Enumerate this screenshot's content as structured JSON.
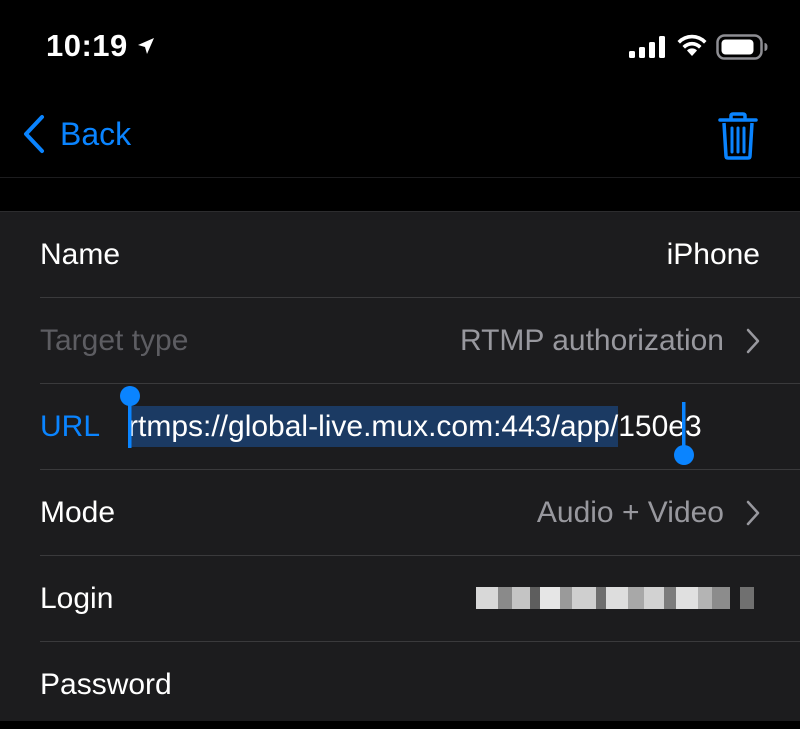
{
  "status_bar": {
    "time": "10:19",
    "icons": [
      "location-arrow-icon",
      "cellular-signal-icon",
      "wifi-icon",
      "battery-icon"
    ]
  },
  "nav": {
    "back_label": "Back",
    "trash_icon": "trash-icon"
  },
  "rows": {
    "name": {
      "label": "Name",
      "value": "iPhone"
    },
    "target_type": {
      "label": "Target type",
      "value": "RTMP authorization"
    },
    "url": {
      "label": "URL",
      "selected_text": "rtmps://global-live.mux.com:443/app/",
      "trailing_text": "150e3"
    },
    "mode": {
      "label": "Mode",
      "value": "Audio + Video"
    },
    "login": {
      "label": "Login",
      "value_redacted": true
    },
    "password": {
      "label": "Password"
    }
  },
  "colors": {
    "accent": "#0a84ff",
    "background": "#000000",
    "cell_background": "#1c1c1e",
    "separator": "#3a3a3c",
    "secondary_text": "#98989e",
    "disabled_text": "#5d5d62",
    "selection": "#1b3a63"
  }
}
